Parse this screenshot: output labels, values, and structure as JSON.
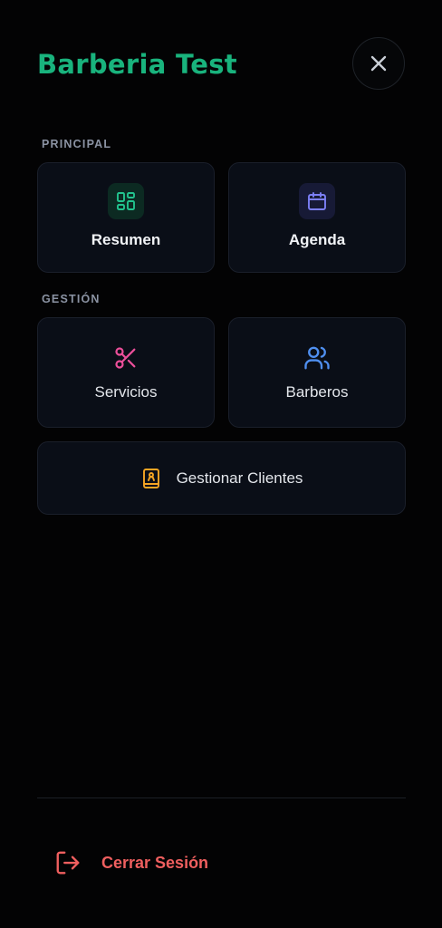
{
  "header": {
    "title": "Barberia Test",
    "close_icon": "close-icon"
  },
  "sections": {
    "principal": "PRINCIPAL",
    "gestion": "GESTIÓN"
  },
  "tiles": {
    "resumen": {
      "label": "Resumen",
      "icon": "dashboard-grid-icon",
      "color": "#22c38e"
    },
    "agenda": {
      "label": "Agenda",
      "icon": "calendar-icon",
      "color": "#7c7ff5"
    },
    "servicios": {
      "label": "Servicios",
      "icon": "scissors-icon",
      "color": "#ec4f9a"
    },
    "barberos": {
      "label": "Barberos",
      "icon": "users-icon",
      "color": "#4f8ff0"
    },
    "clientes": {
      "label": "Gestionar Clientes",
      "icon": "contact-book-icon",
      "color": "#f5a524"
    }
  },
  "footer": {
    "logout_label": "Cerrar Sesión",
    "logout_icon": "logout-icon",
    "logout_color": "#ef5f5f"
  }
}
